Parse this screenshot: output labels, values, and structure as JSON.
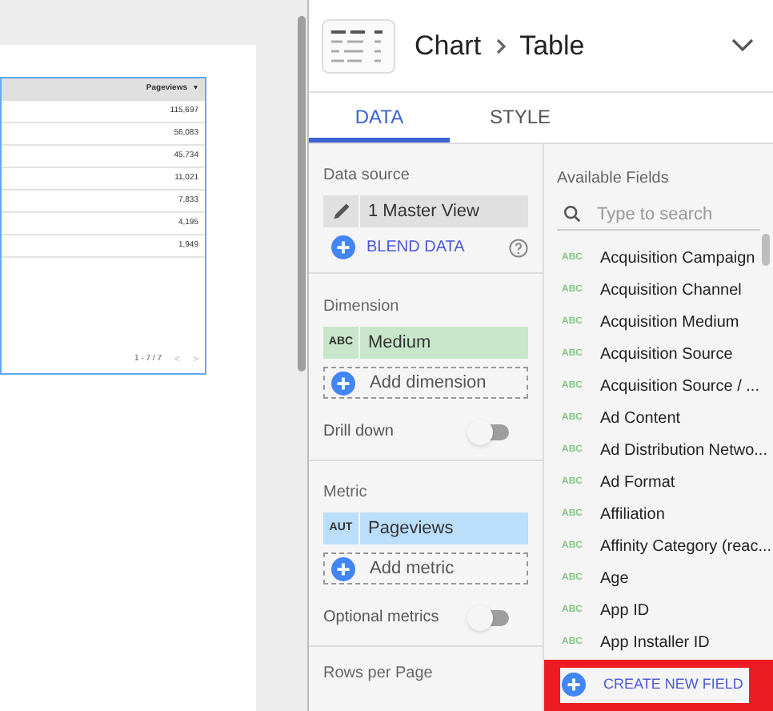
{
  "report_table": {
    "column": "Pageviews",
    "sort_glyph": "▾",
    "rows": [
      "115,697",
      "56,083",
      "45,734",
      "11,021",
      "7,833",
      "4,195",
      "1,949"
    ],
    "pagination": "1 - 7 / 7",
    "prev_glyph": "<",
    "next_glyph": ">"
  },
  "panel": {
    "breadcrumb": "Chart",
    "chart_type": "Table",
    "tabs": [
      {
        "label": "DATA",
        "selected": true
      },
      {
        "label": "STYLE",
        "selected": false
      }
    ],
    "data_source": {
      "heading": "Data source",
      "name": "1 Master View",
      "blend": "BLEND DATA"
    },
    "dimension": {
      "heading": "Dimension",
      "field": {
        "type": "ABC",
        "name": "Medium"
      },
      "add": "Add dimension"
    },
    "drill_down": {
      "label": "Drill down",
      "on": false
    },
    "metric": {
      "heading": "Metric",
      "field": {
        "type": "AUT",
        "name": "Pageviews"
      },
      "add": "Add metric"
    },
    "optional_metrics": {
      "label": "Optional metrics",
      "on": false
    },
    "rows_per_page": {
      "heading": "Rows per Page"
    },
    "available_fields": {
      "heading": "Available Fields",
      "placeholder": "Type to search",
      "fields": [
        {
          "type": "ABC",
          "name": "Acquisition Campaign"
        },
        {
          "type": "ABC",
          "name": "Acquisition Channel"
        },
        {
          "type": "ABC",
          "name": "Acquisition Medium"
        },
        {
          "type": "ABC",
          "name": "Acquisition Source"
        },
        {
          "type": "ABC",
          "name": "Acquisition Source / ..."
        },
        {
          "type": "ABC",
          "name": "Ad Content"
        },
        {
          "type": "ABC",
          "name": "Ad Distribution Netwo..."
        },
        {
          "type": "ABC",
          "name": "Ad Format"
        },
        {
          "type": "ABC",
          "name": "Affiliation"
        },
        {
          "type": "ABC",
          "name": "Affinity Category (reac..."
        },
        {
          "type": "ABC",
          "name": "Age"
        },
        {
          "type": "ABC",
          "name": "App ID"
        },
        {
          "type": "ABC",
          "name": "App Installer ID"
        }
      ],
      "create": "CREATE NEW FIELD",
      "create_highlighted": true
    }
  }
}
